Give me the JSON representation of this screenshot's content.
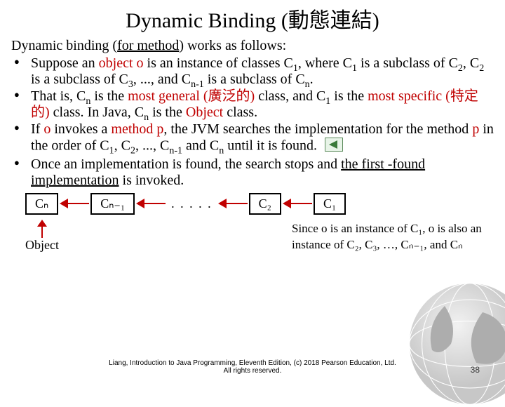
{
  "title": "Dynamic Binding (動態連結)",
  "intro_pre": "Dynamic binding (",
  "intro_ul": "for method",
  "intro_post": ") works as follows:",
  "b1": {
    "t1": "Suppose an ",
    "r1": "object o",
    "t2": " is an instance of classes C",
    "t3": ", where C",
    "t4": " is a subclass of C",
    "t5": ", C",
    "t6": " is a subclass of C",
    "t7": ", ..., and C",
    "t8": " is a subclass of C",
    "t9": "."
  },
  "b2": {
    "t1": "That is, C",
    "t2": " is the ",
    "r1": "most general (廣泛的)",
    "t3": " class, and C",
    "t4": " is the ",
    "r2": "most specific (特定的)",
    "t5": " class. In Java, C",
    "t6": " is the ",
    "r3": "Object",
    "t7": " class."
  },
  "b3": {
    "t1": "If ",
    "r1": "o",
    "t2": " invokes a ",
    "r2": "method p",
    "t3": ", the JVM searches the implementation for the method ",
    "r3": "p",
    "t4": " in the order of C",
    "t5": ", C",
    "t6": ", ..., C",
    "t7": " and C",
    "t8": " until it is found."
  },
  "b4": {
    "t1": "Once an implementation is found, the search stops and ",
    "u1": "the first -found implementation",
    "t2": " is invoked."
  },
  "diagram": {
    "cn": "Cₙ",
    "cn1": "Cₙ₋₁",
    "dots": ". . . . .",
    "c2": "C₂",
    "c1": "C₁",
    "obj": "Object",
    "since1": "Since o is an instance of C₁, o is also an",
    "since2": "instance of C₂, C₃, …, Cₙ₋₁, and Cₙ"
  },
  "footer": {
    "line1": "Liang, Introduction to Java Programming, Eleventh Edition, (c) 2018 Pearson Education, Ltd.",
    "line2": "All rights reserved.",
    "page": "38"
  },
  "icons": {
    "prev": "previous-slide-icon"
  }
}
